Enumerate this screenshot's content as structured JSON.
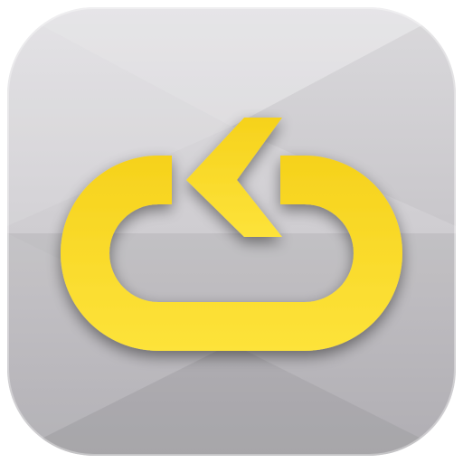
{
  "app_icon": {
    "glyph": "loop-arrow-icon",
    "colors": {
      "tile_light": "#e1e0e3",
      "tile_mid": "#cfcdd1",
      "tile_dark": "#bcbabf",
      "glyph_yellow": "#f6d21c",
      "glyph_yellow_light": "#fde33a",
      "glyph_shadow": "#3a3a3a"
    }
  }
}
